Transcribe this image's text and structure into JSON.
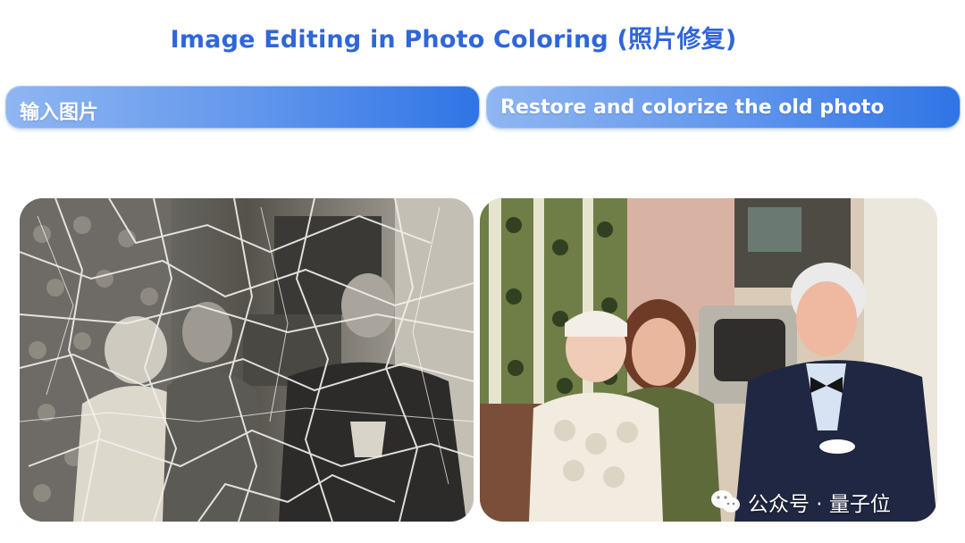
{
  "header": {
    "title": "Image Editing in Photo Coloring (照片修复)"
  },
  "panels": {
    "input_label": "输入图片",
    "output_label": "Restore and colorize the old photo"
  },
  "watermark": {
    "text": "公众号 · 量子位"
  },
  "colors": {
    "title": "#2f66d9",
    "pill_start": "#8fb6f2",
    "pill_end": "#2f74e6"
  }
}
